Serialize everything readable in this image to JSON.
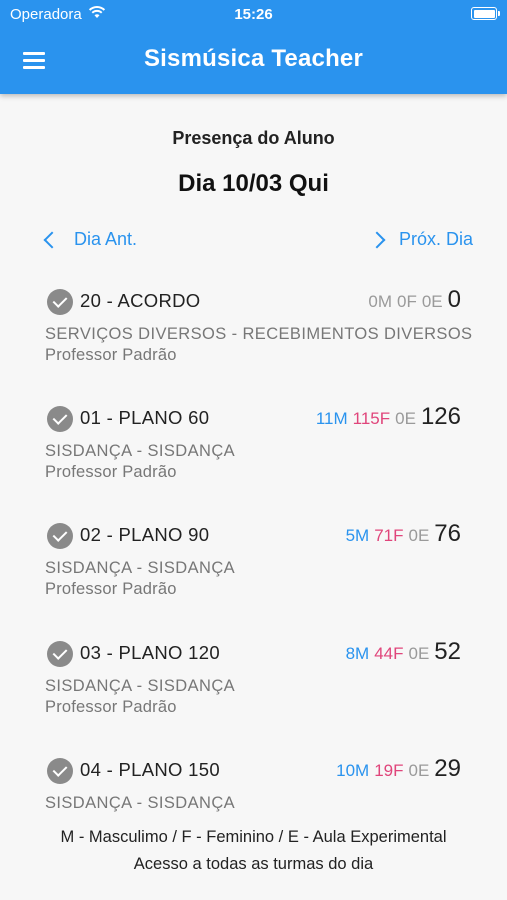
{
  "status_bar": {
    "carrier": "Operadora",
    "time": "15:26"
  },
  "app_bar": {
    "title": "Sismúsica Teacher"
  },
  "header": {
    "subtitle": "Presença do Aluno",
    "day": "Dia 10/03 Qui"
  },
  "nav": {
    "prev_label": "Dia Ant.",
    "next_label": "Próx. Dia"
  },
  "classes": [
    {
      "title": "20 - ACORDO",
      "m": "0M",
      "f": "0F",
      "e": "0E",
      "total": "0",
      "course": "SERVIÇOS DIVERSOS - RECEBIMENTOS DIVERSOS",
      "teacher": "Professor Padrão"
    },
    {
      "title": "01 - PLANO 60",
      "m": "11M",
      "f": "115F",
      "e": "0E",
      "total": "126",
      "course": "SISDANÇA - SISDANÇA",
      "teacher": "Professor Padrão"
    },
    {
      "title": "02 - PLANO 90",
      "m": "5M",
      "f": "71F",
      "e": "0E",
      "total": "76",
      "course": "SISDANÇA - SISDANÇA",
      "teacher": "Professor Padrão"
    },
    {
      "title": "03 - PLANO 120",
      "m": "8M",
      "f": "44F",
      "e": "0E",
      "total": "52",
      "course": "SISDANÇA - SISDANÇA",
      "teacher": "Professor Padrão"
    },
    {
      "title": "04 - PLANO 150",
      "m": "10M",
      "f": "19F",
      "e": "0E",
      "total": "29",
      "course": "SISDANÇA - SISDANÇA",
      "teacher": ""
    }
  ],
  "footer": {
    "legend": "M - Masculimo / F - Feminino / E - Aula Experimental",
    "note": "Acesso a todas as turmas do dia"
  },
  "colors": {
    "accent": "#2a93ee",
    "male": "#2a93ee",
    "female": "#e0457b",
    "muted": "#9a9a9a"
  }
}
